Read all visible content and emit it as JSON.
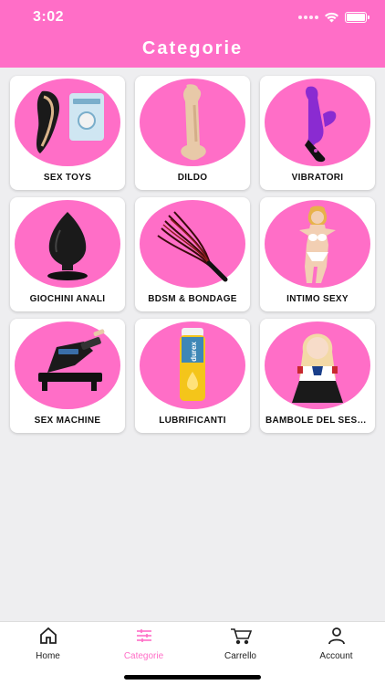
{
  "status": {
    "time": "3:02"
  },
  "header": {
    "title": "Categorie"
  },
  "categories": [
    {
      "label": "SEX TOYS",
      "icon": "suction-toy-icon"
    },
    {
      "label": "DILDO",
      "icon": "dildo-icon"
    },
    {
      "label": "VIBRATORI",
      "icon": "vibrator-icon"
    },
    {
      "label": "GIOCHINI ANALI",
      "icon": "plug-icon"
    },
    {
      "label": "BDSM & BONDAGE",
      "icon": "whip-icon"
    },
    {
      "label": "INTIMO SEXY",
      "icon": "lingerie-icon"
    },
    {
      "label": "SEX MACHINE",
      "icon": "machine-icon"
    },
    {
      "label": "LUBRIFICANTI",
      "icon": "lube-bottle-icon"
    },
    {
      "label": "BAMBOLE DEL SESSO",
      "icon": "doll-icon"
    }
  ],
  "tabs": [
    {
      "label": "Home",
      "icon": "home-icon",
      "active": false
    },
    {
      "label": "Categorie",
      "icon": "sliders-icon",
      "active": true
    },
    {
      "label": "Carrello",
      "icon": "cart-icon",
      "active": false
    },
    {
      "label": "Account",
      "icon": "user-icon",
      "active": false
    }
  ],
  "colors": {
    "accent": "#ff6ec7",
    "background": "#eeeef0"
  }
}
